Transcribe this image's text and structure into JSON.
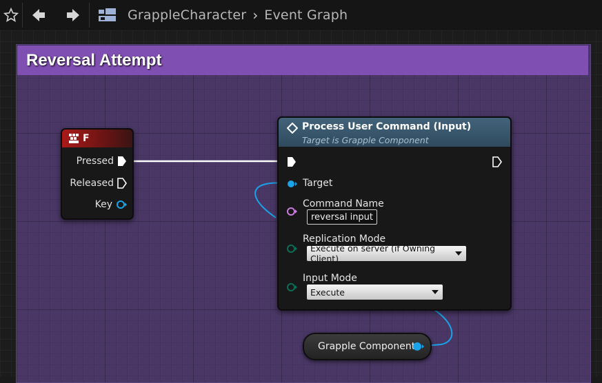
{
  "toolbar": {
    "breadcrumb": {
      "blueprint": "GrappleCharacter",
      "graph": "Event Graph"
    }
  },
  "comment": {
    "title": "Reversal Attempt"
  },
  "key_event_node": {
    "title": "F",
    "pins": {
      "pressed": "Pressed",
      "released": "Released",
      "key": "Key"
    }
  },
  "function_node": {
    "title": "Process User Command (Input)",
    "subtitle": "Target is Grapple Component",
    "target_label": "Target",
    "command_name_label": "Command Name",
    "command_name_value": "reversal input",
    "replication_mode_label": "Replication Mode",
    "replication_mode_value": "Execute on server (if Owning Client)",
    "input_mode_label": "Input Mode",
    "input_mode_value": "Execute"
  },
  "variable_node": {
    "label": "Grapple Component"
  },
  "colors": {
    "exec": "#ffffff",
    "object_pin": "#1aa3e8",
    "string_pin": "#c97ddc",
    "enum_pin": "#0a6e58",
    "comment_header": "#7f4fb2",
    "comment_body": "#4a3766",
    "function_header": "#3a566b",
    "key_header": "#aa1a1a"
  },
  "icons": [
    "star-icon",
    "back-arrow-icon",
    "forward-arrow-icon",
    "blueprint-graph-icon",
    "function-icon",
    "keyboard-icon",
    "breadcrumb-chevron-icon"
  ]
}
